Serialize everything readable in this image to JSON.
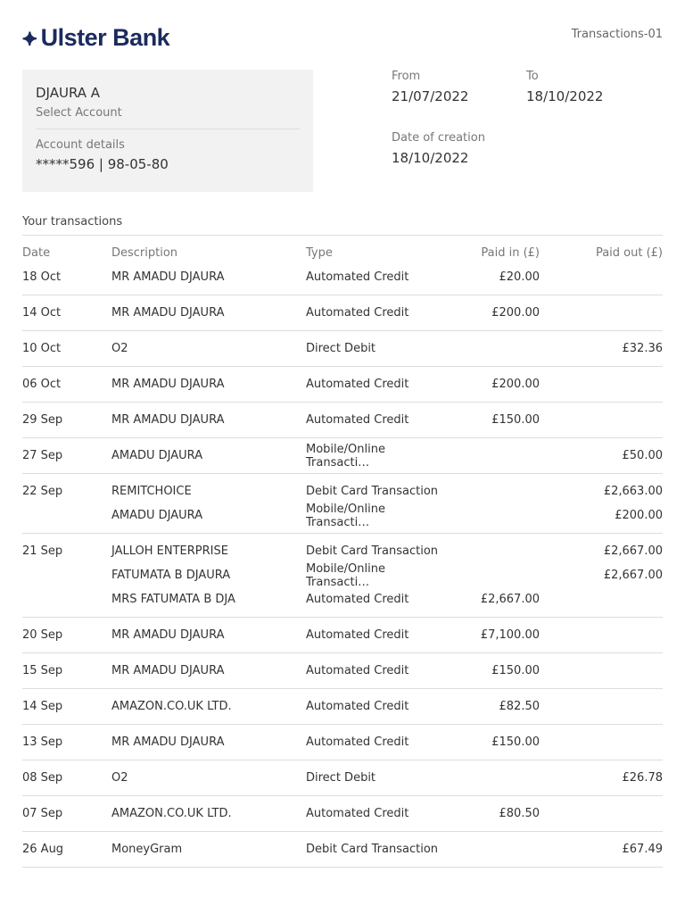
{
  "header": {
    "bank_name": "Ulster Bank",
    "doc_id": "Transactions-01"
  },
  "account": {
    "name": "DJAURA A",
    "select_label": "Select Account",
    "details_label": "Account details",
    "number": "*****596 | 98-05-80"
  },
  "period": {
    "from_label": "From",
    "from": "21/07/2022",
    "to_label": "To",
    "to": "18/10/2022",
    "created_label": "Date of creation",
    "created": "18/10/2022"
  },
  "transactions": {
    "title": "Your transactions",
    "columns": [
      "Date",
      "Description",
      "Type",
      "Paid in (£)",
      "Paid out (£)"
    ],
    "groups": [
      {
        "date": "18 Oct",
        "entries": [
          {
            "description": "MR AMADU DJAURA",
            "type": "Automated Credit",
            "paid_in": "£20.00",
            "paid_out": ""
          }
        ]
      },
      {
        "date": "14 Oct",
        "entries": [
          {
            "description": "MR AMADU DJAURA",
            "type": "Automated Credit",
            "paid_in": "£200.00",
            "paid_out": ""
          }
        ]
      },
      {
        "date": "10 Oct",
        "entries": [
          {
            "description": "O2",
            "type": "Direct Debit",
            "paid_in": "",
            "paid_out": "£32.36"
          }
        ]
      },
      {
        "date": "06 Oct",
        "entries": [
          {
            "description": "MR AMADU DJAURA",
            "type": "Automated Credit",
            "paid_in": "£200.00",
            "paid_out": ""
          }
        ]
      },
      {
        "date": "29 Sep",
        "entries": [
          {
            "description": "MR AMADU DJAURA",
            "type": "Automated Credit",
            "paid_in": "£150.00",
            "paid_out": ""
          }
        ]
      },
      {
        "date": "27 Sep",
        "entries": [
          {
            "description": "AMADU DJAURA",
            "type": "Mobile/Online Transacti…",
            "paid_in": "",
            "paid_out": "£50.00"
          }
        ]
      },
      {
        "date": "22 Sep",
        "entries": [
          {
            "description": "REMITCHOICE",
            "type": "Debit Card Transaction",
            "paid_in": "",
            "paid_out": "£2,663.00"
          },
          {
            "description": "AMADU DJAURA",
            "type": "Mobile/Online Transacti…",
            "paid_in": "",
            "paid_out": "£200.00"
          }
        ]
      },
      {
        "date": "21 Sep",
        "entries": [
          {
            "description": "JALLOH ENTERPRISE",
            "type": "Debit Card Transaction",
            "paid_in": "",
            "paid_out": "£2,667.00"
          },
          {
            "description": "FATUMATA B DJAURA",
            "type": "Mobile/Online Transacti…",
            "paid_in": "",
            "paid_out": "£2,667.00"
          },
          {
            "description": "MRS FATUMATA B DJA",
            "type": "Automated Credit",
            "paid_in": "£2,667.00",
            "paid_out": ""
          }
        ]
      },
      {
        "date": "20 Sep",
        "entries": [
          {
            "description": "MR AMADU DJAURA",
            "type": "Automated Credit",
            "paid_in": "£7,100.00",
            "paid_out": ""
          }
        ]
      },
      {
        "date": "15 Sep",
        "entries": [
          {
            "description": "MR AMADU DJAURA",
            "type": "Automated Credit",
            "paid_in": "£150.00",
            "paid_out": ""
          }
        ]
      },
      {
        "date": "14 Sep",
        "entries": [
          {
            "description": "AMAZON.CO.UK LTD.",
            "type": "Automated Credit",
            "paid_in": "£82.50",
            "paid_out": ""
          }
        ]
      },
      {
        "date": "13 Sep",
        "entries": [
          {
            "description": "MR AMADU DJAURA",
            "type": "Automated Credit",
            "paid_in": "£150.00",
            "paid_out": ""
          }
        ]
      },
      {
        "date": "08 Sep",
        "entries": [
          {
            "description": "O2",
            "type": "Direct Debit",
            "paid_in": "",
            "paid_out": "£26.78"
          }
        ]
      },
      {
        "date": "07 Sep",
        "entries": [
          {
            "description": "AMAZON.CO.UK LTD.",
            "type": "Automated Credit",
            "paid_in": "£80.50",
            "paid_out": ""
          }
        ]
      },
      {
        "date": "26 Aug",
        "entries": [
          {
            "description": "MoneyGram",
            "type": "Debit Card Transaction",
            "paid_in": "",
            "paid_out": "£67.49"
          }
        ]
      }
    ]
  }
}
